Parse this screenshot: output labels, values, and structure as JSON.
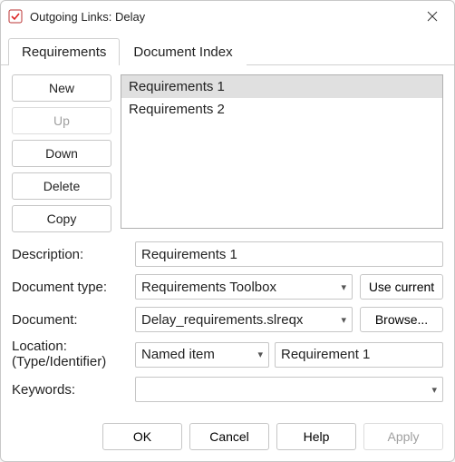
{
  "window": {
    "title": "Outgoing Links: Delay"
  },
  "tabs": {
    "requirements": "Requirements",
    "docindex": "Document Index"
  },
  "sidebar": {
    "new": "New",
    "up": "Up",
    "down": "Down",
    "delete": "Delete",
    "copy": "Copy"
  },
  "list": {
    "items": [
      "Requirements 1",
      "Requirements 2"
    ],
    "selected": 0
  },
  "form": {
    "description_label": "Description:",
    "description_value": "Requirements 1",
    "doctype_label": "Document type:",
    "doctype_value": "Requirements Toolbox",
    "usecurrent": "Use current",
    "document_label": "Document:",
    "document_value": "Delay_requirements.slreqx",
    "browse": "Browse...",
    "location_label_line1": "Location:",
    "location_label_line2": "(Type/Identifier)",
    "location_type": "Named item",
    "location_id": "Requirement 1",
    "keywords_label": "Keywords:",
    "keywords_value": ""
  },
  "footer": {
    "ok": "OK",
    "cancel": "Cancel",
    "help": "Help",
    "apply": "Apply"
  }
}
